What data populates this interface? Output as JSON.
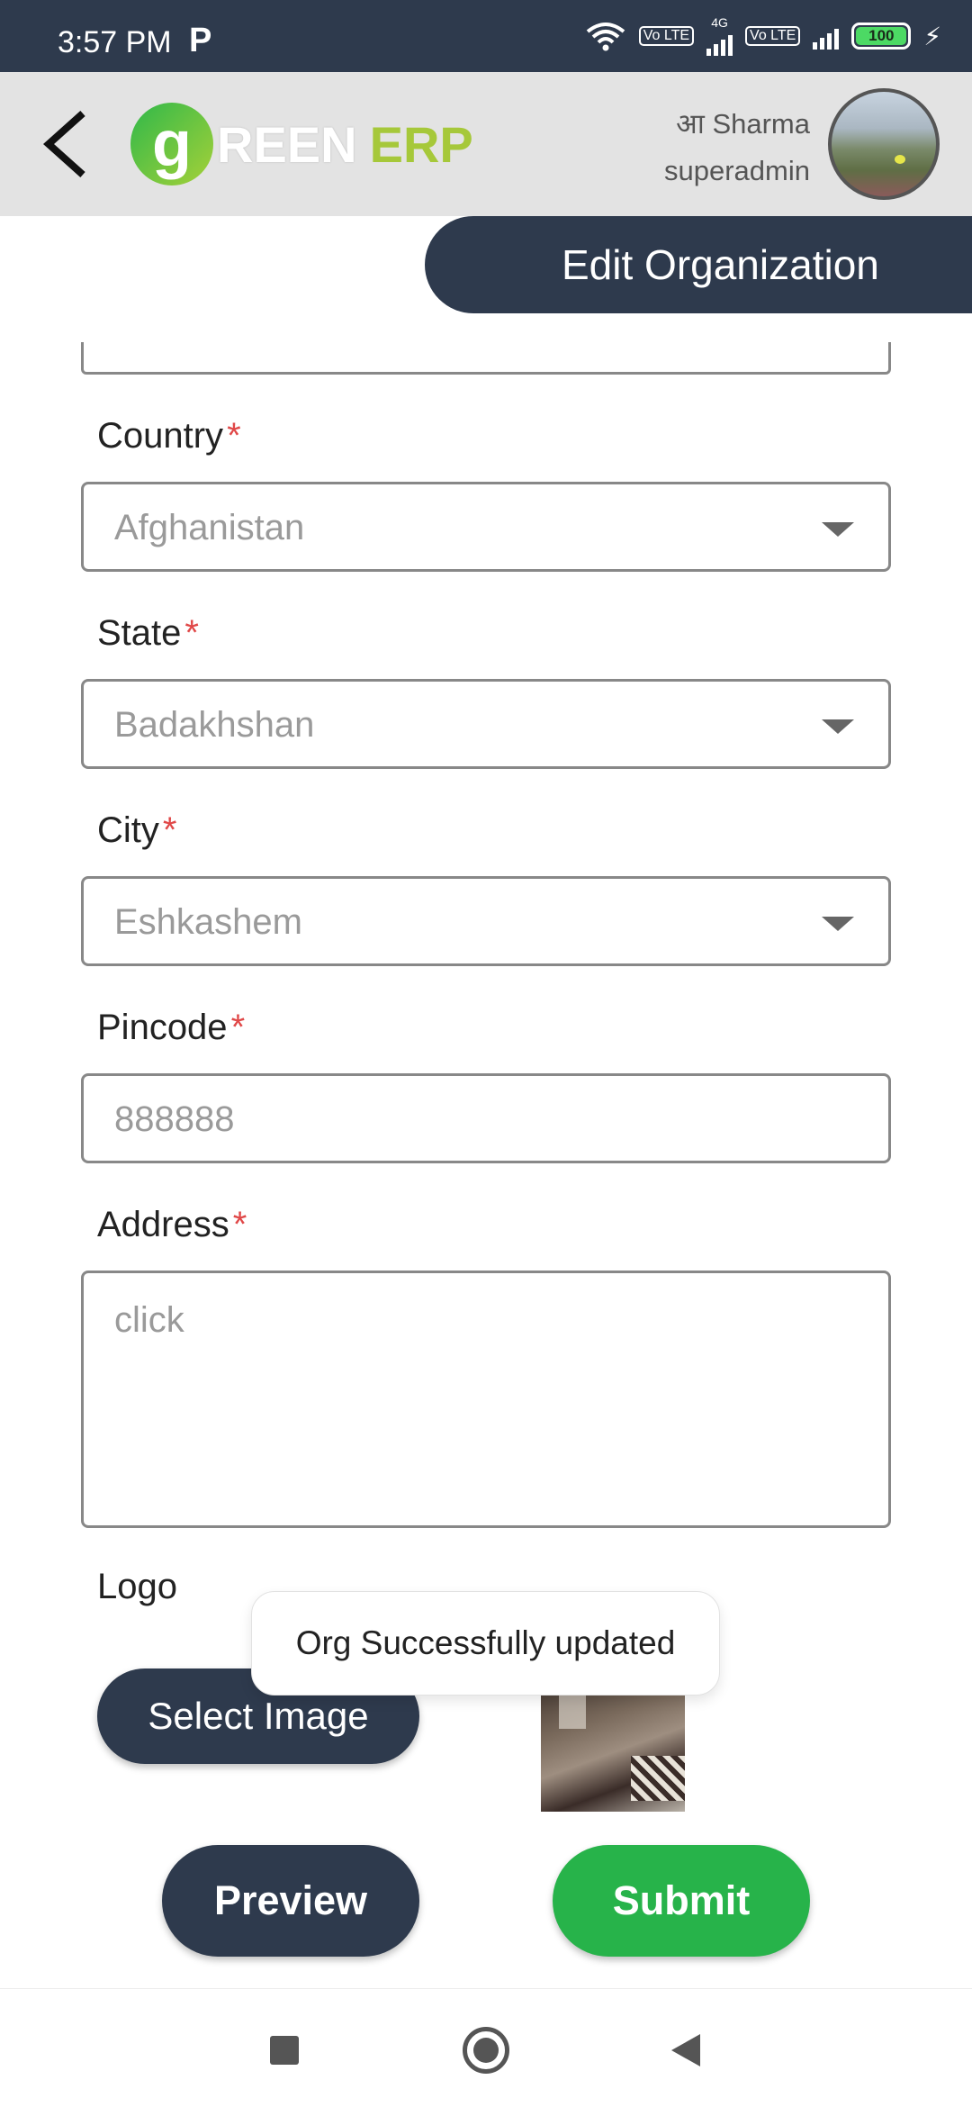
{
  "status_bar": {
    "time": "3:57 PM",
    "app_indicator": "P",
    "volte1": "Vo LTE",
    "network": "4G",
    "volte2": "Vo LTE",
    "battery": "100"
  },
  "header": {
    "logo": {
      "g": "g",
      "reen": "REEN",
      "erp": "ERP"
    },
    "user_name": "आ Sharma",
    "user_role": "superadmin"
  },
  "page_title": "Edit Organization",
  "form": {
    "country": {
      "label": "Country",
      "required": "*",
      "value": "Afghanistan"
    },
    "state": {
      "label": "State",
      "required": "*",
      "value": "Badakhshan"
    },
    "city": {
      "label": "City",
      "required": "*",
      "value": "Eshkashem"
    },
    "pincode": {
      "label": "Pincode",
      "required": "*",
      "placeholder": "888888"
    },
    "address": {
      "label": "Address",
      "required": "*",
      "placeholder": "click"
    },
    "logo": {
      "label": "Logo",
      "select_button": "Select Image"
    }
  },
  "toast": "Org Successfully updated",
  "actions": {
    "preview": "Preview",
    "submit": "Submit"
  },
  "colors": {
    "primary": "#2e3a4d",
    "success": "#27b34a",
    "required": "#e04848",
    "brand_light": "#a6c83a"
  },
  "icons": [
    "back-arrow-icon",
    "wifi-icon",
    "signal-icon",
    "battery-icon",
    "charging-icon",
    "dropdown-caret-icon",
    "recents-nav-icon",
    "home-nav-icon",
    "back-nav-icon"
  ]
}
